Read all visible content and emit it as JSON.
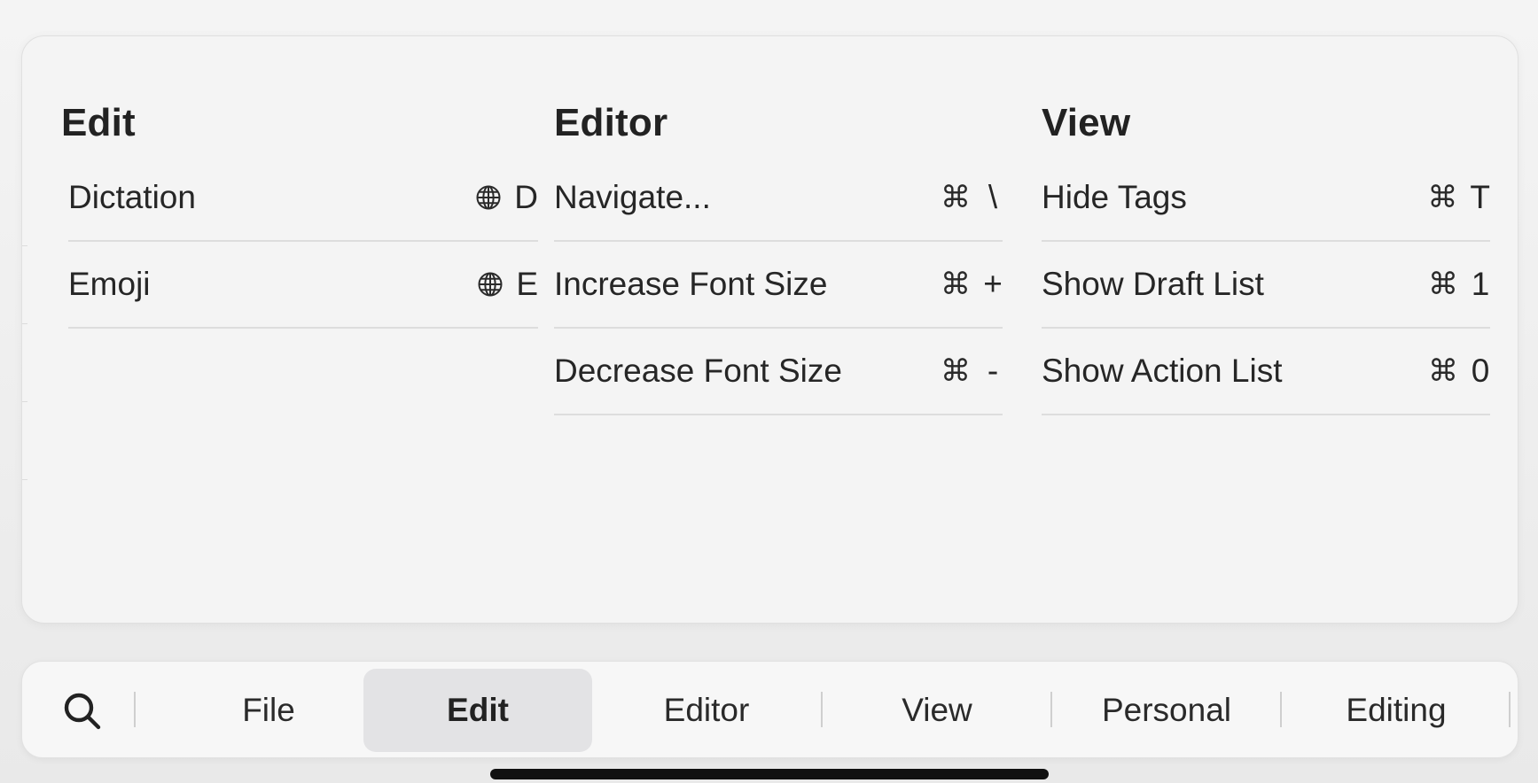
{
  "panel": {
    "columns": [
      {
        "title": "Edit",
        "items": [
          {
            "label": "Dictation",
            "modifier_icon": "globe-icon",
            "key": "D"
          },
          {
            "label": "Emoji",
            "modifier_icon": "globe-icon",
            "key": "E"
          }
        ]
      },
      {
        "title": "Editor",
        "items": [
          {
            "label": "Navigate...",
            "modifier": "⌘",
            "key": "\\"
          },
          {
            "label": "Increase Font Size",
            "modifier": "⌘",
            "key": "+"
          },
          {
            "label": "Decrease Font Size",
            "modifier": "⌘",
            "key": "-"
          }
        ]
      },
      {
        "title": "View",
        "items": [
          {
            "label": "Hide Tags",
            "modifier": "⌘",
            "key": "T"
          },
          {
            "label": "Show Draft List",
            "modifier": "⌘",
            "key": "1"
          },
          {
            "label": "Show Action List",
            "modifier": "⌘",
            "key": "0"
          }
        ]
      }
    ]
  },
  "tabbar": {
    "search_icon": "search-icon",
    "tabs": [
      {
        "label": "File",
        "active": false
      },
      {
        "label": "Edit",
        "active": true
      },
      {
        "label": "Editor",
        "active": false
      },
      {
        "label": "View",
        "active": false
      },
      {
        "label": "Personal",
        "active": false
      },
      {
        "label": "Editing",
        "active": false
      }
    ]
  },
  "colors": {
    "panel_bg": "#f4f4f4",
    "active_tab_bg": "#e3e3e5",
    "divider": "#dddddd",
    "home_indicator": "#111111"
  }
}
